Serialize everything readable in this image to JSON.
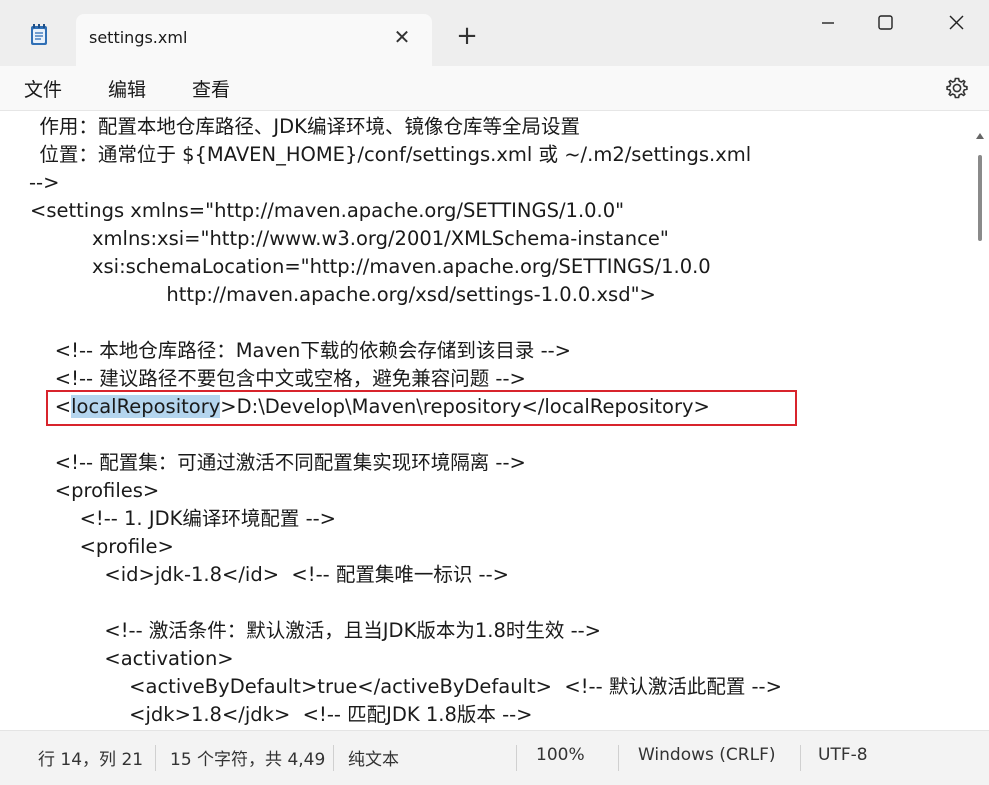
{
  "window": {
    "tab_title": "settings.xml",
    "close_tab_glyph": "✕",
    "new_tab_glyph": "+"
  },
  "menu": {
    "file": "文件",
    "edit": "编辑",
    "view": "查看"
  },
  "editor": {
    "lines": [
      "  作用：配置本地仓库路径、JDK编译环境、镜像仓库等全局设置",
      "  位置：通常位于 ${MAVEN_HOME}/conf/settings.xml 或 ~/.m2/settings.xml",
      "-->",
      "<settings xmlns=\"http://maven.apache.org/SETTINGS/1.0.0\"",
      "          xmlns:xsi=\"http://www.w3.org/2001/XMLSchema-instance\"",
      "          xsi:schemaLocation=\"http://maven.apache.org/SETTINGS/1.0.0",
      "                      http://maven.apache.org/xsd/settings-1.0.0.xsd\">",
      "",
      "    <!-- 本地仓库路径：Maven下载的依赖会存储到该目录 -->",
      "    <!-- 建议路径不要包含中文或空格，避免兼容问题 -->",
      "    <localRepository>D:\\Develop\\Maven\\repository</localRepository>",
      "",
      "    <!-- 配置集：可通过激活不同配置集实现环境隔离 -->",
      "    <profiles>",
      "        <!-- 1. JDK编译环境配置 -->",
      "        <profile>",
      "            <id>jdk-1.8</id>  <!-- 配置集唯一标识 -->",
      "",
      "            <!-- 激活条件：默认激活，且当JDK版本为1.8时生效 -->",
      "            <activation>",
      "                <activeByDefault>true</activeByDefault>  <!-- 默认激活此配置 -->",
      "                <jdk>1.8</jdk>  <!-- 匹配JDK 1.8版本 -->"
    ],
    "selected_line": {
      "indent": "    <",
      "selected": "localRepository",
      "rest": ">D:\\Develop\\Maven\\repository</localRepository>"
    }
  },
  "status": {
    "position": "行 14，列 21",
    "chars": "15 个字符，共 4,49",
    "format": "纯文本",
    "zoom": "100%",
    "line_ending": "Windows (CRLF)",
    "encoding": "UTF-8"
  },
  "colors": {
    "highlight_border": "#d8242c",
    "selection": "#b4d5ee"
  }
}
